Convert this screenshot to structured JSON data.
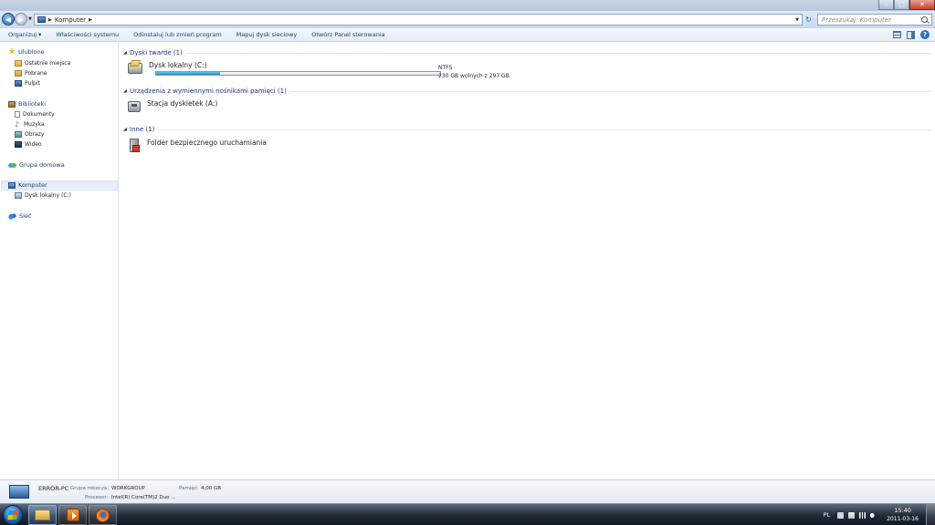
{
  "address": {
    "path": "Komputer",
    "search_placeholder": "Przeszukaj: Komputer"
  },
  "toolbar": {
    "organize": "Organizuj ▾",
    "system_properties": "Właściwości systemu",
    "uninstall": "Odinstaluj lub zmień program",
    "map_drive": "Mapuj dysk sieciowy",
    "control_panel": "Otwórz Panel sterowania"
  },
  "sidebar": {
    "favorites": {
      "label": "Ulubione",
      "items": [
        "Ostatnie miejsca",
        "Pobrane",
        "Pulpit"
      ]
    },
    "libraries": {
      "label": "Biblioteki",
      "items": [
        "Dokumenty",
        "Muzyka",
        "Obrazy",
        "Wideo"
      ]
    },
    "homegroup": "Grupa domowa",
    "computer": {
      "label": "Komputer",
      "items": [
        "Dysk lokalny (C:)"
      ]
    },
    "network": "Sieć"
  },
  "groups": {
    "hard_drives": {
      "title": "Dyski twarde (1)",
      "drive_name": "Dysk lokalny (C:)",
      "filesystem": "NTFS",
      "free_space": "230 GB wolnych z 297 GB",
      "used_fraction": 0.226
    },
    "removable": {
      "title": "Urządzenia z wymiennymi nośnikami pamięci (1)",
      "item": "Stacja dyskietek (A:)"
    },
    "other": {
      "title": "Inne (1)",
      "item": "Folder bezpiecznego uruchamiania"
    }
  },
  "details": {
    "computer_name": "ERROR-PC",
    "workgroup_label": "Grupa robocza:",
    "workgroup_value": "WORKGROUP",
    "memory_label": "Pamięć:",
    "memory_value": "4,00 GB",
    "processor_label": "Procesor:",
    "processor_value": "Intel(R) Core(TM)2 Duo ..."
  },
  "taskbar": {
    "language": "PL",
    "time": "15:40",
    "date": "2011-03-16"
  }
}
